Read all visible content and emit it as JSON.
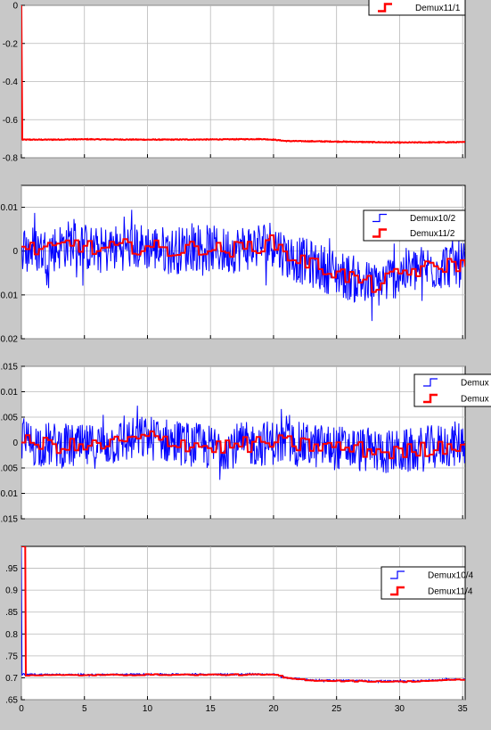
{
  "chart_data": [
    {
      "type": "line",
      "grid": true,
      "legend_position": "top-right",
      "xlim": [
        0,
        35.2
      ],
      "ylim": [
        -0.8,
        0
      ],
      "x_ticks": [
        0,
        5,
        10,
        15,
        20,
        25,
        30,
        35
      ],
      "y_tick_labels": [
        "0",
        "-0.2",
        "-0.4",
        "-0.6",
        "-0.8"
      ],
      "y_tick_values": [
        0,
        -0.2,
        -0.4,
        -0.6,
        -0.8
      ],
      "series": [
        {
          "name": "Demux11/1",
          "color": "#ff0000",
          "show_legend": true,
          "x": [
            0,
            0.02,
            2,
            5,
            10,
            15,
            19,
            20,
            21,
            25,
            30,
            35.2
          ],
          "y": [
            0,
            -0.705,
            -0.705,
            -0.703,
            -0.705,
            -0.704,
            -0.702,
            -0.705,
            -0.712,
            -0.715,
            -0.72,
            -0.718
          ]
        }
      ]
    },
    {
      "type": "line",
      "grid": true,
      "legend_position": "top-right",
      "xlim": [
        0,
        35.2
      ],
      "ylim": [
        -0.02,
        0.015
      ],
      "x_ticks": [
        0,
        5,
        10,
        15,
        20,
        25,
        30,
        35
      ],
      "y_tick_labels": [
        "0.01",
        "0",
        "-0.01",
        "-0.02"
      ],
      "y_tick_values": [
        0.01,
        0,
        -0.01,
        -0.02
      ],
      "series": [
        {
          "name": "Demux10/2",
          "color": "#0000ff",
          "show_legend": true,
          "x": [
            0,
            2,
            4,
            6,
            8,
            10,
            12,
            14,
            16,
            18,
            20,
            21,
            22,
            24,
            26,
            28,
            30,
            32,
            34,
            35.2
          ],
          "y": [
            0.001,
            0.0,
            0.002,
            0.0,
            0.001,
            0.001,
            0.0,
            0.001,
            0.0,
            0.001,
            0.002,
            -0.001,
            -0.002,
            -0.004,
            -0.006,
            -0.008,
            -0.005,
            -0.004,
            -0.003,
            -0.003
          ],
          "noise": 0.0055
        },
        {
          "name": "Demux11/2",
          "color": "#ff0000",
          "show_legend": true,
          "x": [
            0,
            2,
            4,
            6,
            8,
            10,
            12,
            14,
            16,
            18,
            20,
            21,
            22,
            24,
            26,
            28,
            30,
            32,
            34,
            35.2
          ],
          "y": [
            0.001,
            0.0,
            0.002,
            0.0,
            0.001,
            0.001,
            0.0,
            0.001,
            0.0,
            0.001,
            0.002,
            -0.001,
            -0.002,
            -0.004,
            -0.006,
            -0.008,
            -0.005,
            -0.004,
            -0.003,
            -0.003
          ],
          "noise": 0.0018
        }
      ]
    },
    {
      "type": "line",
      "grid": true,
      "legend_position": "top-right",
      "xlim": [
        0,
        35.2
      ],
      "ylim": [
        -0.015,
        0.015
      ],
      "x_ticks": [
        0,
        5,
        10,
        15,
        20,
        25,
        30,
        35
      ],
      "y_tick_labels": [
        ".015",
        "0.01",
        ".005",
        "0",
        ".005",
        "-0.01",
        ".015"
      ],
      "y_tick_values": [
        0.015,
        0.01,
        0.005,
        0,
        -0.005,
        -0.01,
        -0.015
      ],
      "series": [
        {
          "name": "Demux",
          "color": "#0000ff",
          "show_legend": true,
          "x": [
            0,
            5,
            10,
            15,
            20,
            25,
            30,
            35.2
          ],
          "y": [
            0.0,
            -0.001,
            0.001,
            -0.001,
            0.0,
            -0.001,
            -0.002,
            0.0
          ],
          "noise": 0.0045
        },
        {
          "name": "Demux",
          "color": "#ff0000",
          "show_legend": true,
          "x": [
            0,
            5,
            10,
            15,
            20,
            25,
            30,
            35.2
          ],
          "y": [
            0.0,
            -0.001,
            0.001,
            -0.001,
            0.0,
            -0.001,
            -0.002,
            0.0
          ],
          "noise": 0.0016
        }
      ]
    },
    {
      "type": "line",
      "grid": true,
      "legend_position": "top-right",
      "xlim": [
        0,
        35.2
      ],
      "ylim": [
        0.65,
        1.0
      ],
      "x_ticks": [
        0,
        5,
        10,
        15,
        20,
        25,
        30,
        35
      ],
      "x_tick_labels": [
        "0",
        "5",
        "10",
        "15",
        "20",
        "25",
        "30",
        "35"
      ],
      "y_tick_labels": [
        ".95",
        "0.9",
        ".85",
        "0.8",
        ".75",
        "0.7",
        ".65"
      ],
      "y_tick_values": [
        0.95,
        0.9,
        0.85,
        0.8,
        0.75,
        0.7,
        0.65
      ],
      "series": [
        {
          "name": "Demux10/4",
          "color": "#0000ff",
          "show_legend": true,
          "x": [
            0,
            0.02,
            5,
            10,
            15,
            20,
            21,
            23,
            25,
            30,
            35.2
          ],
          "y": [
            1.0,
            0.708,
            0.707,
            0.708,
            0.708,
            0.708,
            0.7,
            0.695,
            0.694,
            0.692,
            0.697
          ],
          "noise": 0.002
        },
        {
          "name": "Demux11/4",
          "color": "#ff0000",
          "show_legend": true,
          "x": [
            0,
            0.02,
            5,
            10,
            15,
            20,
            21,
            23,
            25,
            30,
            35.2
          ],
          "y": [
            1.0,
            0.706,
            0.706,
            0.707,
            0.707,
            0.707,
            0.699,
            0.694,
            0.693,
            0.691,
            0.696
          ],
          "noise": 0.0012
        }
      ]
    }
  ]
}
